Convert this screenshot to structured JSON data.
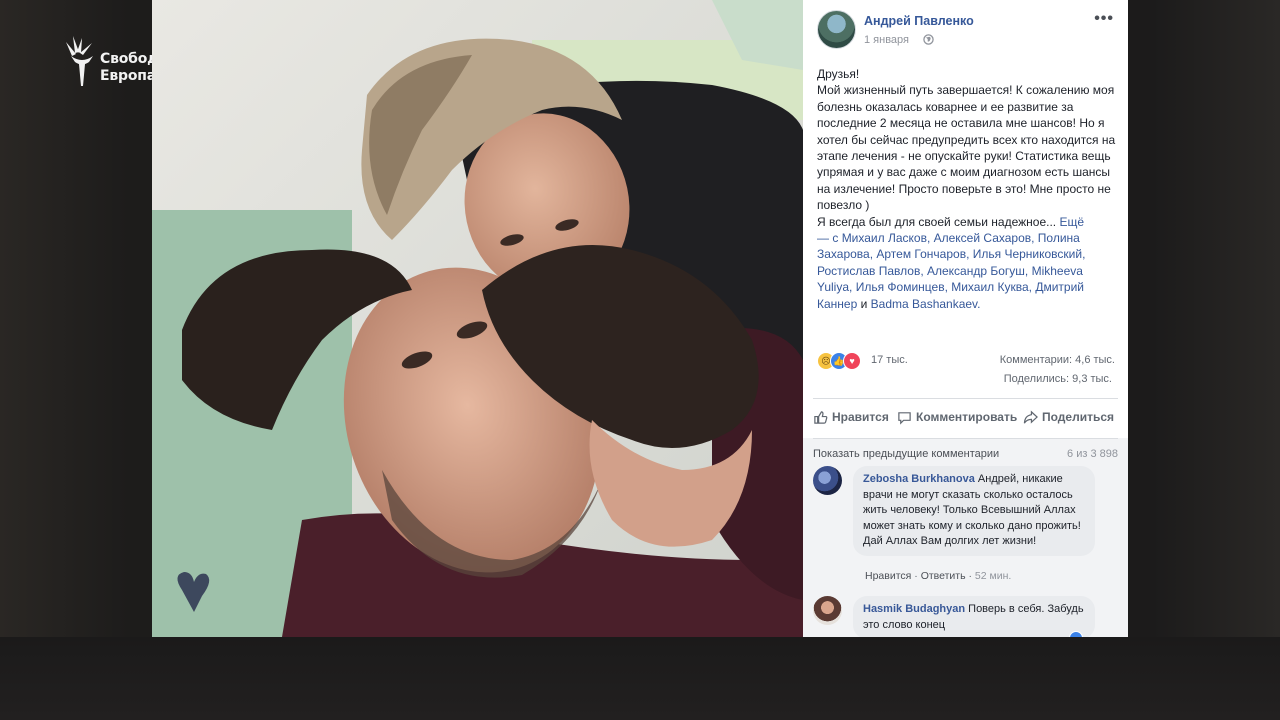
{
  "logo": {
    "line1": "Свобода",
    "line2": "Европа"
  },
  "post": {
    "author": "Андрей Павленко",
    "time": "1 января",
    "text_main": "Друзья!\nМой жизненный путь завершается! К сожалению моя болезнь оказалась коварнее и ее развитие за последние 2 месяца не оставила мне шансов! Но я хотел бы сейчас предупредить всех кто находится на этапе лечения - не опускайте руки! Статистика вещь упрямая и у вас даже с моим диагнозом есть шансы на излечение! Просто поверьте в это! Мне просто не повезло )\nЯ всегда был для своей семьи надежное...",
    "more_label": "Ещё",
    "tag_prefix": "— с",
    "tagged": "Михаил Ласков, Алексей Сахаров, Полина Захарова, Артем Гончаров, Илья Черниковский, Ростислав Павлов, Александр Богуш, Mikheeva Yuliya, Илья Фоминцев, Михаил Куква, Дмитрий Каннер",
    "tag_and": "и",
    "tag_last": "Badma Bashankaev."
  },
  "stats": {
    "reactions": "17 тыс.",
    "comments": "Комментарии: 4,6 тыс.",
    "shares": "Поделились: 9,3 тыс."
  },
  "actions": {
    "like": "Нравится",
    "comment": "Комментировать",
    "share": "Поделиться"
  },
  "comments_section": {
    "show_previous": "Показать предыдущие комментарии",
    "range": "6 из 3 898",
    "items": [
      {
        "author": "Zebosha Burkhanova",
        "text": "Андрей, никакие врачи не могут сказать сколько осталось жить человеку! Только Всевышний Аллах может знать кому и сколько дано прожить! Дай Аллах Вам долгих лет жизни!",
        "like": "Нравится",
        "reply": "Ответить",
        "time": "52 мин."
      },
      {
        "author": "Hasmik Budaghyan",
        "text": "Поверь в себя. Забудь это слово конец"
      }
    ]
  },
  "colors": {
    "link": "#365899",
    "like_blue": "#3b82e8",
    "love_red": "#f0445a",
    "sad_yellow": "#f7c340"
  }
}
